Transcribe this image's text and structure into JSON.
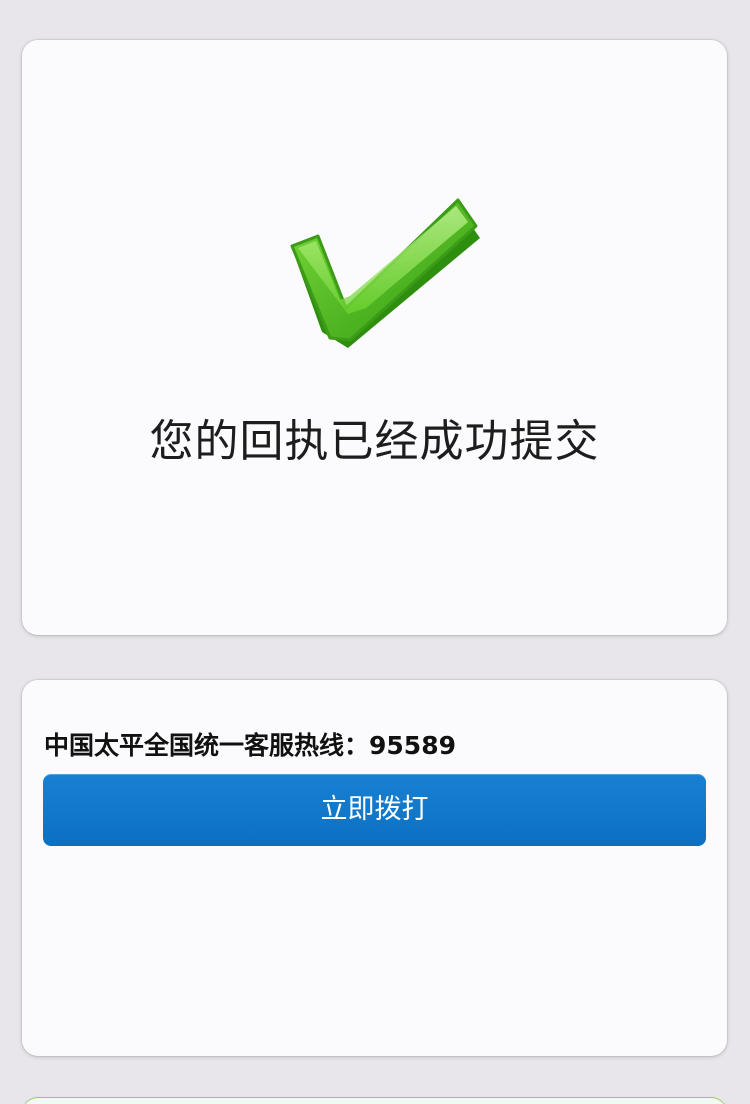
{
  "success": {
    "icon": "green-check-icon",
    "title": "您的回执已经成功提交"
  },
  "hotline": {
    "label": "中国太平全国统一客服热线：",
    "number": "95589",
    "call_button_label": "立即拨打"
  },
  "colors": {
    "background": "#e8e6ea",
    "card": "#fbfafc",
    "button": "#0b74c6",
    "check_green": "#5cc12e"
  }
}
